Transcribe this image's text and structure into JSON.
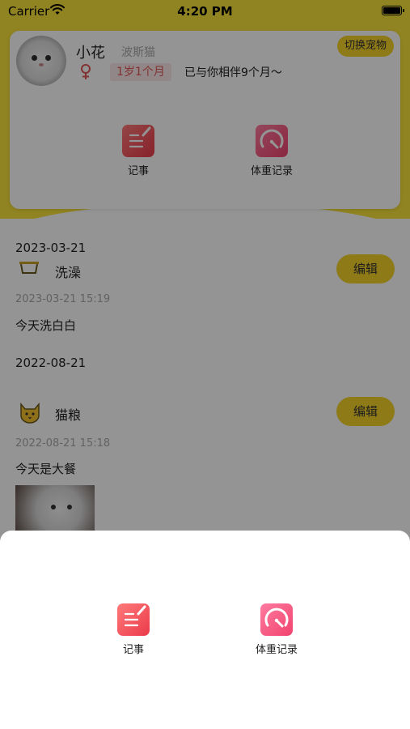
{
  "status_bar": {
    "carrier": "Carrier",
    "time": "4:20 PM"
  },
  "pet": {
    "name": "小花",
    "breed": "波斯猫",
    "age": "1岁1个月",
    "together": "已与你相伴9个月～",
    "switch_label": "切换宠物"
  },
  "card_actions": {
    "note_label": "记事",
    "weight_label": "体重记录"
  },
  "timeline": [
    {
      "date": "2023-03-21",
      "category": "洗澡",
      "time": "2023-03-21 15:19",
      "text": "今天洗白白",
      "edit_label": "编辑"
    },
    {
      "date": "2022-08-21",
      "category": "猫粮",
      "time": "2022-08-21 15:18",
      "text": "今天是大餐",
      "edit_label": "编辑"
    }
  ],
  "sheet": {
    "note_label": "记事",
    "weight_label": "体重记录"
  },
  "colors": {
    "brand_yellow": "#f8e23a",
    "button_yellow": "#f6d32a",
    "note_red": "#ea3a4a",
    "weight_pink": "#f0436e"
  },
  "icons": [
    "wifi-icon",
    "battery-icon",
    "female-icon",
    "note-icon",
    "weight-scale-icon",
    "bath-icon",
    "cat-face-icon"
  ]
}
